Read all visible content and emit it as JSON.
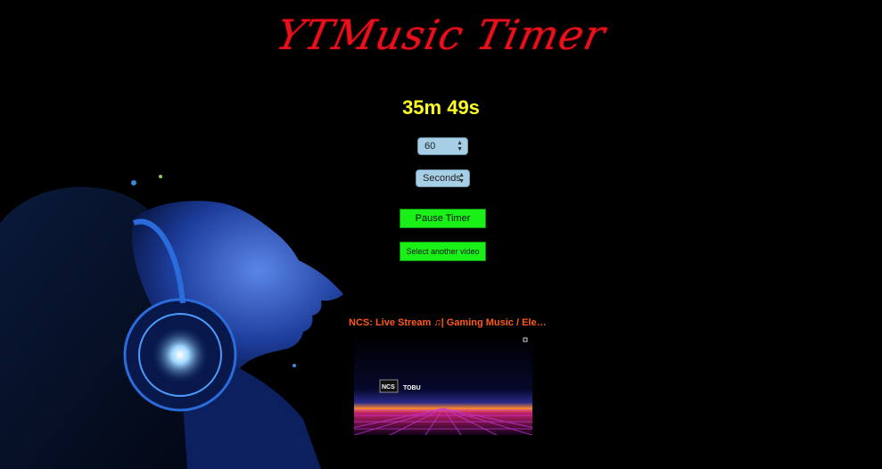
{
  "app": {
    "title": "YTMusic Timer",
    "countdown": "35m 49s"
  },
  "controls": {
    "duration_value": "60",
    "unit_value": "Seconds",
    "pause_label": "Pause Timer",
    "select_video_label": "Select another video"
  },
  "video": {
    "title": "NCS: Live Stream ♫| Gaming Music / Ele…",
    "thumbnail": {
      "logo": "NCS",
      "artist": "TOBU"
    }
  },
  "colors": {
    "title": "#e8101a",
    "countdown": "#ffff22",
    "button": "#18f018",
    "select": "#a6cfe6",
    "video_title": "#ff5a1a"
  },
  "icons": {
    "select_arrows": "updown-arrows-icon",
    "background": "headphones-woman-art"
  }
}
